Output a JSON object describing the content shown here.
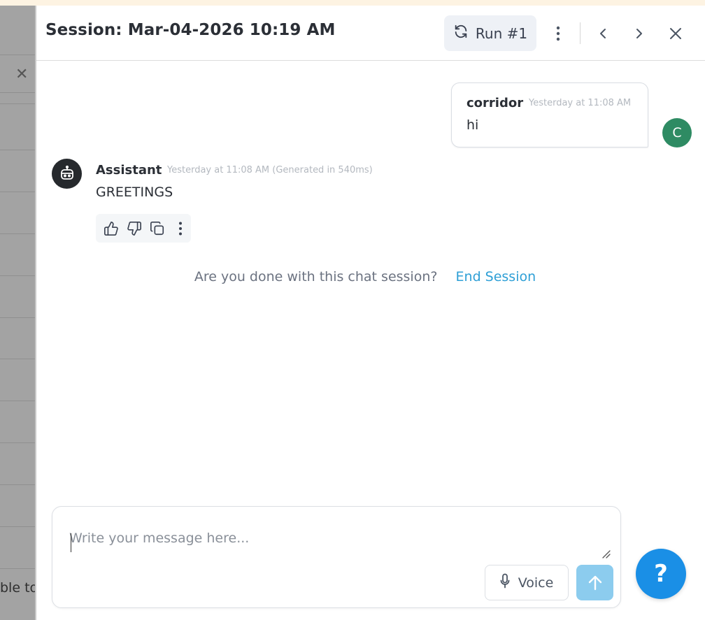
{
  "header": {
    "title": "Session: Mar-04-2026 10:19 AM",
    "run_label": "Run #1"
  },
  "messages": {
    "user": {
      "name": "corridor",
      "time": "Yesterday at 11:08 AM",
      "text": "hi",
      "avatar_letter": "C",
      "avatar_color": "#2e8b63"
    },
    "assistant": {
      "name": "Assistant",
      "time": "Yesterday at 11:08 AM (Generated in 540ms)",
      "text": "GREETINGS"
    }
  },
  "end_session": {
    "question": "Are you done with this chat session?",
    "link": "End Session"
  },
  "composer": {
    "placeholder": "Write your message here...",
    "voice_label": "Voice"
  },
  "help": {
    "label": "?"
  },
  "background": {
    "partial_text": "ble to"
  },
  "colors": {
    "accent": "#2e9fd6",
    "send_button": "#8cccee",
    "help_button": "#1a8fe6"
  }
}
